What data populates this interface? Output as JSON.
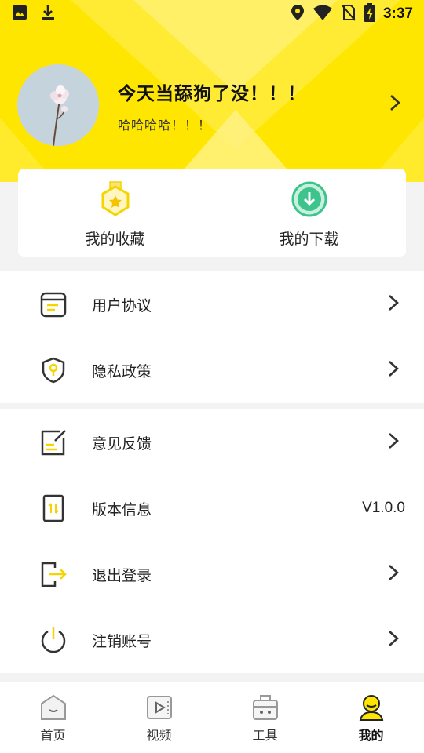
{
  "status_bar": {
    "time": "3:37",
    "icons": [
      "image-icon",
      "download-icon",
      "location-icon",
      "wifi-icon",
      "no-sim-icon",
      "battery-charging-icon"
    ]
  },
  "profile": {
    "name": "今天当舔狗了没！！！",
    "signature": "哈哈哈哈！！！"
  },
  "shortcuts": [
    {
      "label": "我的收藏",
      "icon": "favorites-badge-icon"
    },
    {
      "label": "我的下载",
      "icon": "download-circle-icon"
    }
  ],
  "menu_group1": [
    {
      "label": "用户协议",
      "icon": "agreement-icon"
    },
    {
      "label": "隐私政策",
      "icon": "privacy-shield-icon"
    }
  ],
  "menu_group2": [
    {
      "label": "意见反馈",
      "icon": "feedback-icon"
    },
    {
      "label": "版本信息",
      "icon": "version-icon",
      "value": "V1.0.0"
    },
    {
      "label": "退出登录",
      "icon": "logout-icon"
    },
    {
      "label": "注销账号",
      "icon": "power-icon"
    }
  ],
  "tabs": [
    {
      "label": "首页",
      "icon": "home-icon"
    },
    {
      "label": "视频",
      "icon": "video-icon"
    },
    {
      "label": "工具",
      "icon": "toolbox-icon"
    },
    {
      "label": "我的",
      "icon": "profile-icon",
      "active": true
    }
  ],
  "colors": {
    "accent": "#ffe600",
    "icon_yellow": "#f5d400",
    "download_green": "#3cc48c",
    "background": "#f3f3f3"
  }
}
